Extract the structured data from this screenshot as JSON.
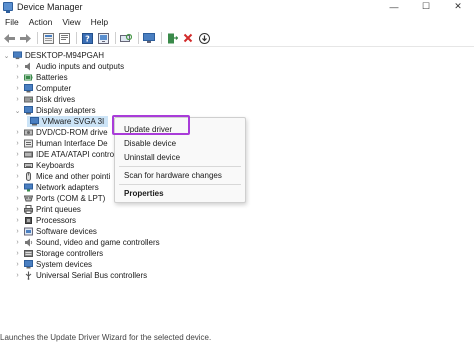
{
  "window": {
    "title": "Device Manager",
    "controls": {
      "minimize": "—",
      "maximize": "☐",
      "close": "✕"
    }
  },
  "menubar": {
    "items": [
      "File",
      "Action",
      "View",
      "Help"
    ]
  },
  "toolbar": {
    "buttons": [
      "back-icon",
      "forward-icon",
      "show-hidden-icon",
      "properties-icon",
      "help-icon",
      "device-icon",
      "scan-icon",
      "update-driver-icon",
      "uninstall-icon",
      "download-icon"
    ]
  },
  "tree": {
    "root": "DESKTOP-M94PGAH",
    "categories": [
      "Audio inputs and outputs",
      "Batteries",
      "Computer",
      "Disk drives",
      "Display adapters",
      "VMware SVGA 3I",
      "DVD/CD-ROM drive",
      "Human Interface De",
      "IDE ATA/ATAPI contro",
      "Keyboards",
      "Mice and other pointi",
      "Network adapters",
      "Ports (COM & LPT)",
      "Print queues",
      "Processors",
      "Software devices",
      "Sound, video and game controllers",
      "Storage controllers",
      "System devices",
      "Universal Serial Bus controllers"
    ]
  },
  "context_menu": {
    "items": [
      "Update driver",
      "Disable device",
      "Uninstall device",
      "Scan for hardware changes",
      "Properties"
    ],
    "highlight_color": "#a93cd9"
  },
  "statusbar": {
    "text": "Launches the Update Driver Wizard for the selected device."
  }
}
